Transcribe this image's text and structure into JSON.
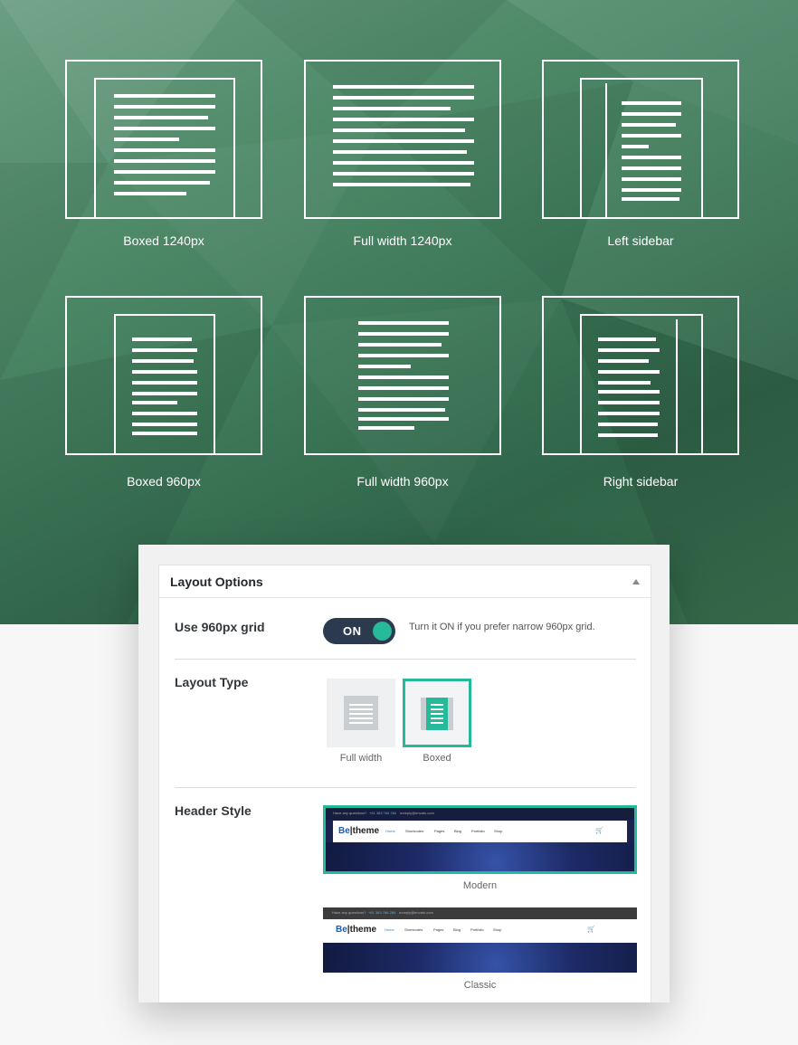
{
  "layouts": [
    {
      "label": "Boxed 1240px"
    },
    {
      "label": "Full width 1240px"
    },
    {
      "label": "Left sidebar"
    },
    {
      "label": "Boxed 960px"
    },
    {
      "label": "Full width 960px"
    },
    {
      "label": "Right sidebar"
    }
  ],
  "panel": {
    "title": "Layout Options",
    "grid": {
      "label": "Use 960px grid",
      "toggle": "ON",
      "hint": "Turn it ON if you prefer narrow 960px grid."
    },
    "layout_type": {
      "label": "Layout Type",
      "options": [
        "Full width",
        "Boxed"
      ],
      "selected": "Boxed"
    },
    "header_style": {
      "label": "Header Style",
      "options": [
        {
          "name": "Modern",
          "selected": true
        },
        {
          "name": "Classic",
          "selected": false
        }
      ],
      "preview": {
        "topbar_question": "Have any questions?",
        "topbar_phone": "+61 383 766 284",
        "topbar_email": "noreply@envato.com",
        "logo_be": "Be",
        "logo_theme": "theme",
        "nav": [
          "Home",
          "Shortcodes",
          "Pages",
          "Blog",
          "Portfolio",
          "Shop"
        ]
      }
    }
  },
  "colors": {
    "accent": "#26b99a",
    "toggle_bg": "#2b3a4e",
    "hero_green": "#3f7a5a"
  }
}
